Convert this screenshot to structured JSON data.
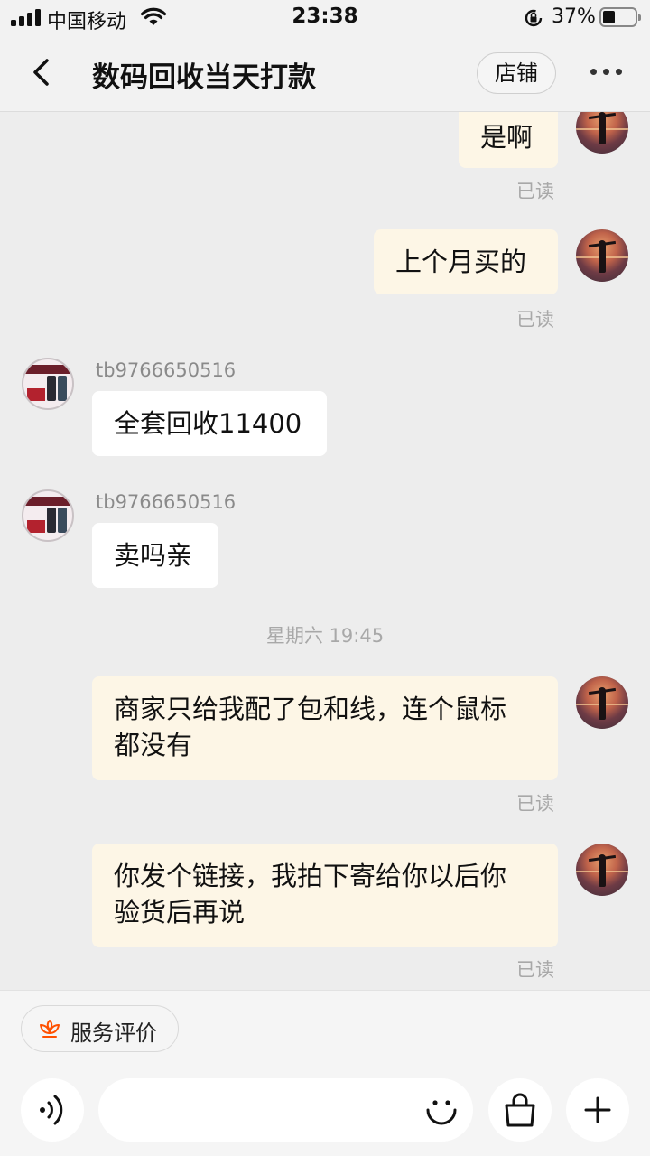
{
  "status_bar": {
    "carrier": "中国移动",
    "time": "23:38",
    "battery": "37%",
    "battery_level": 0.37
  },
  "header": {
    "title": "数码回收当天打款",
    "shop_label": "店铺"
  },
  "messages": {
    "m1": {
      "text": "是啊",
      "read": "已读"
    },
    "m2": {
      "text": "上个月买的",
      "read": "已读"
    },
    "m3": {
      "sender": "tb9766650516",
      "text": "全套回收11400"
    },
    "m4": {
      "sender": "tb9766650516",
      "text": "卖吗亲"
    },
    "timestamp": "星期六 19:45",
    "m5": {
      "line1": "商家只给我配了包和线，连个鼠标",
      "line2": "都没有",
      "read": "已读"
    },
    "m6": {
      "line1": "你发个链接，我拍下寄给你以后你",
      "line2": "验货后再说",
      "read": "已读"
    }
  },
  "bottom": {
    "rating_label": "服务评价",
    "input_placeholder": ""
  },
  "colors": {
    "my_bubble": "#fdf6e6",
    "their_bubble": "#ffffff",
    "background": "#ededed",
    "accent": "#ff5000"
  }
}
